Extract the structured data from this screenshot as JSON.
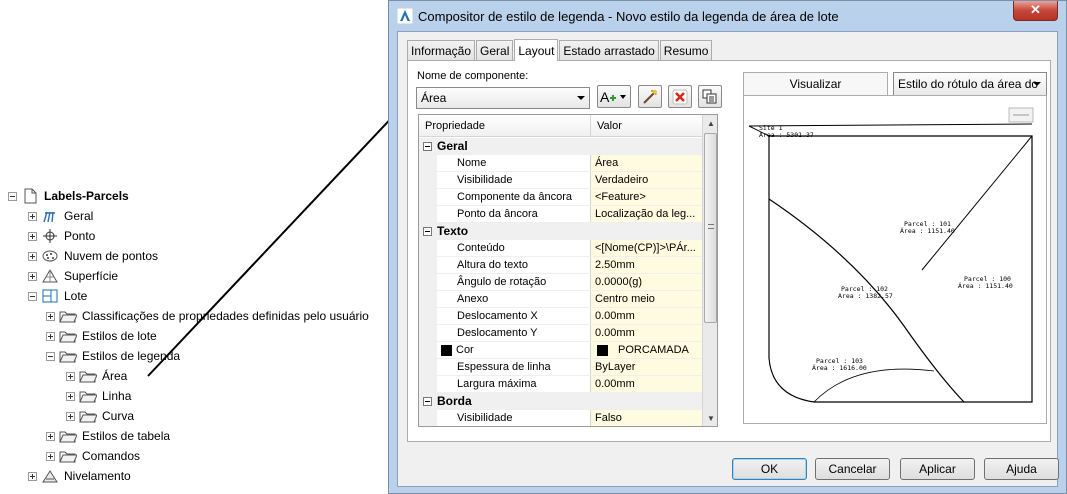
{
  "tree": {
    "items": [
      {
        "label": "Labels-Parcels",
        "icon": "document-icon",
        "level": 0,
        "toggle": "minus",
        "bold": true
      },
      {
        "label": "Geral",
        "icon": "general-icon",
        "level": 1,
        "toggle": "plus"
      },
      {
        "label": "Ponto",
        "icon": "point-icon",
        "level": 1,
        "toggle": "plus"
      },
      {
        "label": "Nuvem de pontos",
        "icon": "point-cloud-icon",
        "level": 1,
        "toggle": "plus"
      },
      {
        "label": "Superfície",
        "icon": "surface-icon",
        "level": 1,
        "toggle": "plus"
      },
      {
        "label": "Lote",
        "icon": "parcel-icon",
        "level": 1,
        "toggle": "minus"
      },
      {
        "label": "Classificações de propriedades definidas pelo usuário",
        "icon": "folder-icon",
        "level": 2,
        "toggle": "plus"
      },
      {
        "label": "Estilos de lote",
        "icon": "folder-icon",
        "level": 2,
        "toggle": "plus"
      },
      {
        "label": "Estilos de legenda",
        "icon": "folder-icon",
        "level": 2,
        "toggle": "minus"
      },
      {
        "label": "Área",
        "icon": "folder-icon",
        "level": 3,
        "toggle": "plus"
      },
      {
        "label": "Linha",
        "icon": "folder-icon",
        "level": 3,
        "toggle": "plus"
      },
      {
        "label": "Curva",
        "icon": "folder-icon",
        "level": 3,
        "toggle": "plus"
      },
      {
        "label": "Estilos de tabela",
        "icon": "folder-icon",
        "level": 2,
        "toggle": "plus"
      },
      {
        "label": "Comandos",
        "icon": "folder-icon",
        "level": 2,
        "toggle": "plus"
      },
      {
        "label": "Nivelamento",
        "icon": "grading-icon",
        "level": 1,
        "toggle": "plus"
      }
    ]
  },
  "dialog": {
    "title": "Compositor de estilo de legenda - Novo estilo da legenda de área de lote",
    "close_label": "✕",
    "tabs": [
      "Informação",
      "Geral",
      "Layout",
      "Estado arrastado",
      "Resumo"
    ],
    "active_tab": "Layout",
    "component_label": "Nome de componente:",
    "component_value": "Área",
    "grid": {
      "col_property": "Propriedade",
      "col_value": "Valor",
      "rows": [
        {
          "type": "category",
          "name": "Geral"
        },
        {
          "type": "prop",
          "name": "Nome",
          "value": "Área"
        },
        {
          "type": "prop",
          "name": "Visibilidade",
          "value": "Verdadeiro"
        },
        {
          "type": "prop",
          "name": "Componente da âncora",
          "value": "<Feature>"
        },
        {
          "type": "prop",
          "name": "Ponto da âncora",
          "value": "Localização da leg..."
        },
        {
          "type": "category",
          "name": "Texto"
        },
        {
          "type": "prop",
          "name": "Conteúdo",
          "value": "<[Nome(CP)]>\\PÁr..."
        },
        {
          "type": "prop",
          "name": "Altura do texto",
          "value": "2.50mm"
        },
        {
          "type": "prop",
          "name": "Ângulo de rotação",
          "value": "0.0000(g)"
        },
        {
          "type": "prop",
          "name": "Anexo",
          "value": "Centro meio"
        },
        {
          "type": "prop",
          "name": "Deslocamento X",
          "value": "0.00mm"
        },
        {
          "type": "prop",
          "name": "Deslocamento Y",
          "value": "0.00mm"
        },
        {
          "type": "color",
          "name": "Cor",
          "value": "PORCAMADA"
        },
        {
          "type": "prop",
          "name": "Espessura de linha",
          "value": "ByLayer"
        },
        {
          "type": "prop",
          "name": "Largura máxima",
          "value": "0.00mm"
        },
        {
          "type": "category",
          "name": "Borda"
        },
        {
          "type": "prop",
          "name": "Visibilidade",
          "value": "Falso"
        }
      ]
    },
    "preview": {
      "label": "Visualizar",
      "style_select": "Estilo do rótulo da área do",
      "labels": [
        {
          "text": "Site 1"
        },
        {
          "text": "Area : 5301.37"
        },
        {
          "text": "Parcel : 101"
        },
        {
          "text": "Área : 1151.40"
        },
        {
          "text": "Parcel : 102"
        },
        {
          "text": "Area : 1382.57"
        },
        {
          "text": "Parcel : 100"
        },
        {
          "text": "Área : 1151.40"
        },
        {
          "text": "Parcel : 103"
        },
        {
          "text": "Área : 1616.00"
        }
      ]
    },
    "buttons": {
      "ok": "OK",
      "cancel": "Cancelar",
      "apply": "Aplicar",
      "help": "Ajuda"
    }
  },
  "colors": {
    "title_bg": "#b9d1ea",
    "value_bg": "#fffbe0",
    "close_red": "#c7463a"
  }
}
